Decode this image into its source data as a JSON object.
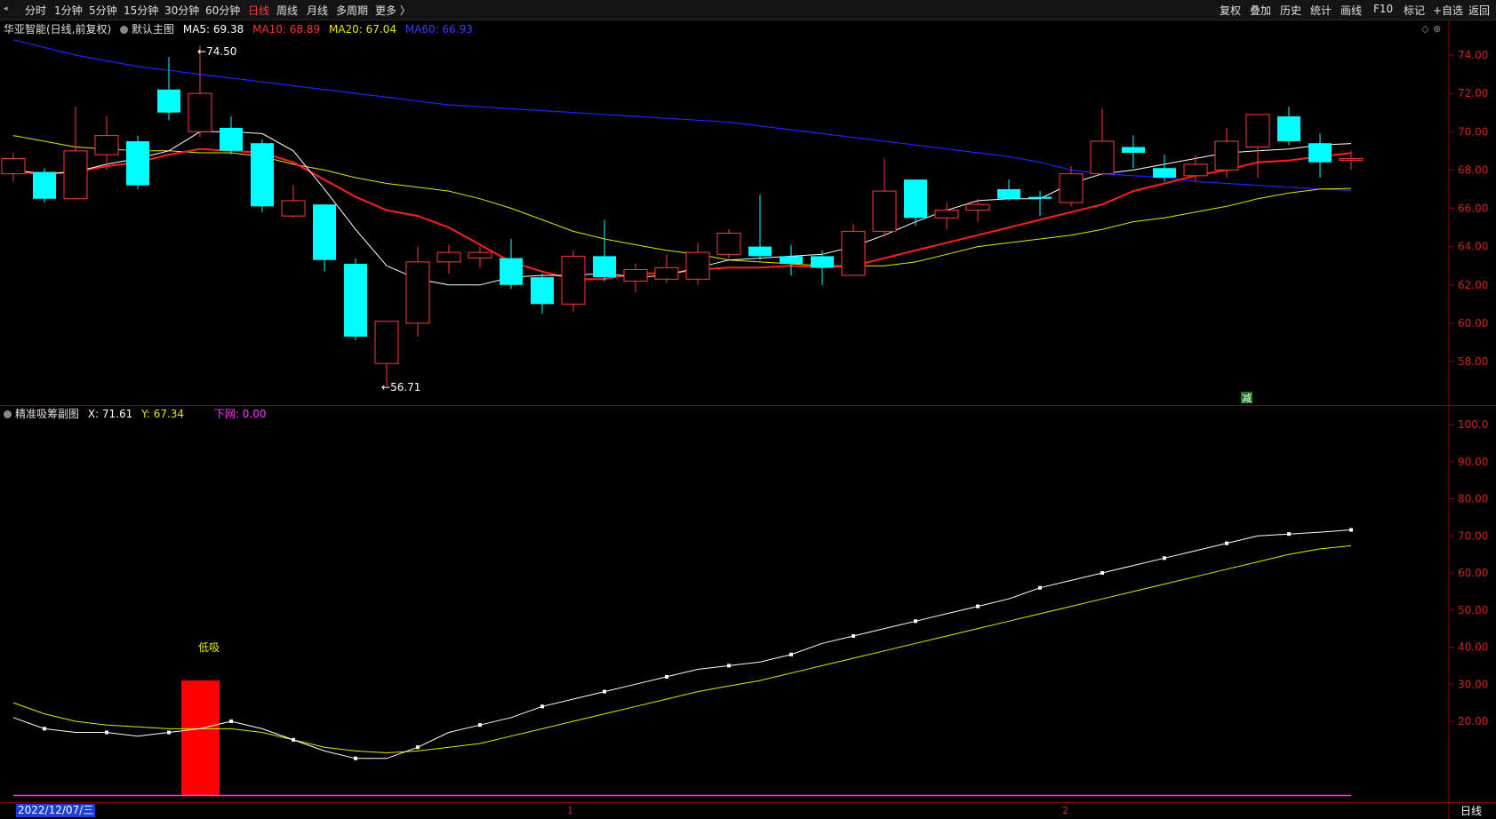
{
  "toolbar": {
    "left": [
      "分时",
      "1分钟",
      "5分钟",
      "15分钟",
      "30分钟",
      "60分钟",
      "日线",
      "周线",
      "月线",
      "多周期",
      "更多 〉"
    ],
    "active": "日线",
    "right": [
      "复权",
      "叠加",
      "历史",
      "统计",
      "画线",
      "F10",
      "标记",
      "+自选",
      "返回"
    ]
  },
  "main": {
    "stock": "华亚智能(日线,前复权)",
    "template": "默认主图",
    "ma5": "MA5: 69.38",
    "ma10": "MA10: 68.89",
    "ma20": "MA20: 67.04",
    "ma60": "MA60: 66.93",
    "max_label": "74.50",
    "min_label": "56.71",
    "reduce_marker": "减",
    "axis_labels": [
      "74.00",
      "72.00",
      "70.00",
      "68.00",
      "66.00",
      "64.00",
      "62.00",
      "60.00",
      "58.00"
    ]
  },
  "sub": {
    "name": "精准吸筹副图",
    "x": "X: 71.61",
    "y": "Y: 67.34",
    "net": "下网: 0.00",
    "signal": "低吸",
    "axis_labels": [
      "100.0",
      "90.00",
      "80.00",
      "70.00",
      "60.00",
      "50.00",
      "40.00",
      "30.00",
      "20.00"
    ]
  },
  "footer": {
    "date": "2022/12/07/三",
    "month1": "1",
    "month2": "2",
    "period": "日线"
  },
  "colors": {
    "up": "#ff3b3b",
    "down": "#00ffff",
    "ma5": "#ffffff",
    "ma10": "#ff2020",
    "ma20": "#e6e600",
    "ma60": "#2222ff",
    "net": "#ff33ff",
    "grid_border": "#8b0000"
  },
  "chart_data": [
    {
      "type": "candlestick",
      "title": "华亚智能(日线,前复权)",
      "ylim": [
        56,
        75.5
      ],
      "candles": [
        {
          "o": 67.8,
          "c": 68.6,
          "h": 68.9,
          "l": 67.4
        },
        {
          "o": 67.9,
          "c": 66.5,
          "h": 68.1,
          "l": 66.3
        },
        {
          "o": 66.5,
          "c": 69.0,
          "h": 71.3,
          "l": 66.5
        },
        {
          "o": 68.8,
          "c": 69.8,
          "h": 70.8,
          "l": 68.0
        },
        {
          "o": 69.5,
          "c": 67.2,
          "h": 69.8,
          "l": 67.0
        },
        {
          "o": 72.2,
          "c": 71.0,
          "h": 73.9,
          "l": 70.6
        },
        {
          "o": 70.0,
          "c": 72.0,
          "h": 74.5,
          "l": 69.7
        },
        {
          "o": 70.2,
          "c": 69.0,
          "h": 70.8,
          "l": 68.8
        },
        {
          "o": 69.4,
          "c": 66.1,
          "h": 69.6,
          "l": 65.8
        },
        {
          "o": 65.6,
          "c": 66.4,
          "h": 67.2,
          "l": 65.5
        },
        {
          "o": 66.2,
          "c": 63.3,
          "h": 66.2,
          "l": 62.7
        },
        {
          "o": 63.1,
          "c": 59.3,
          "h": 63.4,
          "l": 59.1
        },
        {
          "o": 57.9,
          "c": 60.1,
          "h": 60.1,
          "l": 56.71
        },
        {
          "o": 60.0,
          "c": 63.2,
          "h": 64.0,
          "l": 59.3
        },
        {
          "o": 63.2,
          "c": 63.7,
          "h": 64.1,
          "l": 62.6
        },
        {
          "o": 63.4,
          "c": 63.7,
          "h": 64.0,
          "l": 62.9
        },
        {
          "o": 63.4,
          "c": 62.0,
          "h": 64.4,
          "l": 61.8
        },
        {
          "o": 62.4,
          "c": 61.0,
          "h": 62.6,
          "l": 60.5
        },
        {
          "o": 61.0,
          "c": 63.5,
          "h": 63.8,
          "l": 60.6
        },
        {
          "o": 63.5,
          "c": 62.4,
          "h": 65.4,
          "l": 62.2
        },
        {
          "o": 62.2,
          "c": 62.8,
          "h": 63.1,
          "l": 61.6
        },
        {
          "o": 62.3,
          "c": 62.9,
          "h": 63.6,
          "l": 62.1
        },
        {
          "o": 62.3,
          "c": 63.7,
          "h": 64.2,
          "l": 62.0
        },
        {
          "o": 63.6,
          "c": 64.7,
          "h": 64.9,
          "l": 63.4
        },
        {
          "o": 64.0,
          "c": 63.5,
          "h": 66.7,
          "l": 63.3
        },
        {
          "o": 63.5,
          "c": 63.1,
          "h": 64.1,
          "l": 62.5
        },
        {
          "o": 63.5,
          "c": 62.9,
          "h": 63.8,
          "l": 62.0
        },
        {
          "o": 62.5,
          "c": 64.8,
          "h": 65.2,
          "l": 62.5
        },
        {
          "o": 64.8,
          "c": 66.9,
          "h": 68.6,
          "l": 64.5
        },
        {
          "o": 67.5,
          "c": 65.5,
          "h": 67.5,
          "l": 65.1
        },
        {
          "o": 65.5,
          "c": 65.9,
          "h": 66.3,
          "l": 64.9
        },
        {
          "o": 65.9,
          "c": 66.2,
          "h": 66.5,
          "l": 65.3
        },
        {
          "o": 67.0,
          "c": 66.5,
          "h": 67.5,
          "l": 66.4
        },
        {
          "o": 66.6,
          "c": 66.5,
          "h": 66.9,
          "l": 65.6
        },
        {
          "o": 66.3,
          "c": 67.8,
          "h": 68.2,
          "l": 66.1
        },
        {
          "o": 67.8,
          "c": 69.5,
          "h": 71.2,
          "l": 67.7
        },
        {
          "o": 69.2,
          "c": 68.9,
          "h": 69.8,
          "l": 68.1
        },
        {
          "o": 68.1,
          "c": 67.6,
          "h": 68.8,
          "l": 67.4
        },
        {
          "o": 67.7,
          "c": 68.3,
          "h": 68.8,
          "l": 67.4
        },
        {
          "o": 68.0,
          "c": 69.5,
          "h": 70.2,
          "l": 67.6
        },
        {
          "o": 69.2,
          "c": 70.9,
          "h": 70.9,
          "l": 67.6
        },
        {
          "o": 70.8,
          "c": 69.5,
          "h": 71.3,
          "l": 69.3
        },
        {
          "o": 69.4,
          "c": 68.4,
          "h": 69.9,
          "l": 67.6
        },
        {
          "o": 68.6,
          "c": 68.6,
          "h": 69.0,
          "l": 68.0
        }
      ],
      "ma5": [
        68.0,
        67.8,
        67.9,
        68.3,
        68.6,
        69.0,
        70.0,
        70.0,
        69.9,
        69.0,
        67.0,
        64.9,
        63.0,
        62.3,
        62.0,
        62.0,
        62.4,
        62.5,
        62.5,
        62.6,
        62.4,
        62.5,
        62.9,
        63.3,
        63.4,
        63.5,
        63.6,
        64.0,
        64.6,
        65.3,
        65.9,
        66.4,
        66.5,
        66.5,
        67.3,
        67.8,
        68.0,
        68.3,
        68.6,
        68.9,
        69.0,
        69.1,
        69.3,
        69.38
      ],
      "ma10": [
        67.9,
        67.8,
        67.9,
        68.2,
        68.4,
        68.8,
        69.1,
        69.0,
        68.9,
        68.4,
        67.5,
        66.6,
        65.9,
        65.6,
        65.0,
        64.1,
        63.2,
        62.7,
        62.3,
        62.3,
        62.6,
        62.6,
        62.8,
        62.9,
        62.9,
        63.0,
        62.9,
        63.0,
        63.4,
        63.8,
        64.2,
        64.6,
        65.0,
        65.4,
        65.8,
        66.2,
        66.9,
        67.3,
        67.7,
        68.0,
        68.4,
        68.5,
        68.7,
        68.89
      ],
      "ma20": [
        69.8,
        69.5,
        69.2,
        69.1,
        69.0,
        69.0,
        68.9,
        68.9,
        68.7,
        68.3,
        68.0,
        67.6,
        67.3,
        67.1,
        66.9,
        66.5,
        66.0,
        65.4,
        64.8,
        64.4,
        64.1,
        63.8,
        63.6,
        63.3,
        63.2,
        63.1,
        63.0,
        63.0,
        63.0,
        63.2,
        63.6,
        64.0,
        64.2,
        64.4,
        64.6,
        64.9,
        65.3,
        65.5,
        65.8,
        66.1,
        66.5,
        66.8,
        67.0,
        67.04
      ],
      "ma60": [
        74.8,
        74.4,
        74.0,
        73.7,
        73.4,
        73.2,
        73.0,
        72.8,
        72.6,
        72.4,
        72.2,
        72.0,
        71.8,
        71.6,
        71.4,
        71.3,
        71.2,
        71.1,
        71.0,
        70.9,
        70.8,
        70.7,
        70.6,
        70.5,
        70.3,
        70.1,
        69.9,
        69.7,
        69.5,
        69.3,
        69.1,
        68.9,
        68.7,
        68.4,
        68.0,
        67.8,
        67.7,
        67.6,
        67.4,
        67.3,
        67.2,
        67.1,
        67.0,
        66.93
      ]
    },
    {
      "type": "line",
      "title": "精准吸筹副图",
      "ylim": [
        0,
        102
      ],
      "series": [
        {
          "name": "X",
          "values": [
            21,
            18,
            17,
            17,
            16,
            17,
            18,
            20,
            18,
            15,
            12,
            10,
            10,
            13,
            17,
            19,
            21,
            24,
            26,
            28,
            30,
            32,
            34,
            35,
            36,
            38,
            41,
            43,
            45,
            47,
            49,
            51,
            53,
            56,
            58,
            60,
            62,
            64,
            66,
            68,
            70,
            70.5,
            71,
            71.61
          ]
        },
        {
          "name": "Y",
          "values": [
            25,
            22,
            20,
            19,
            18.5,
            18,
            18,
            18,
            17,
            15,
            13,
            12,
            11.5,
            12,
            13,
            14,
            16,
            18,
            20,
            22,
            24,
            26,
            28,
            29.5,
            31,
            33,
            35,
            37,
            39,
            41,
            43,
            45,
            47,
            49,
            51,
            53,
            55,
            57,
            59,
            61,
            63,
            65,
            66.5,
            67.34
          ]
        },
        {
          "name": "下网",
          "values": [
            0,
            0,
            0,
            0,
            0,
            0,
            0,
            0,
            0,
            0,
            0,
            0,
            0,
            0,
            0,
            0,
            0,
            0,
            0,
            0,
            0,
            0,
            0,
            0,
            0,
            0,
            0,
            0,
            0,
            0,
            0,
            0,
            0,
            0,
            0,
            0,
            0,
            0,
            0,
            0,
            0,
            0,
            0,
            0
          ]
        }
      ],
      "bars": [
        {
          "index": 6,
          "value": 31
        }
      ]
    }
  ]
}
